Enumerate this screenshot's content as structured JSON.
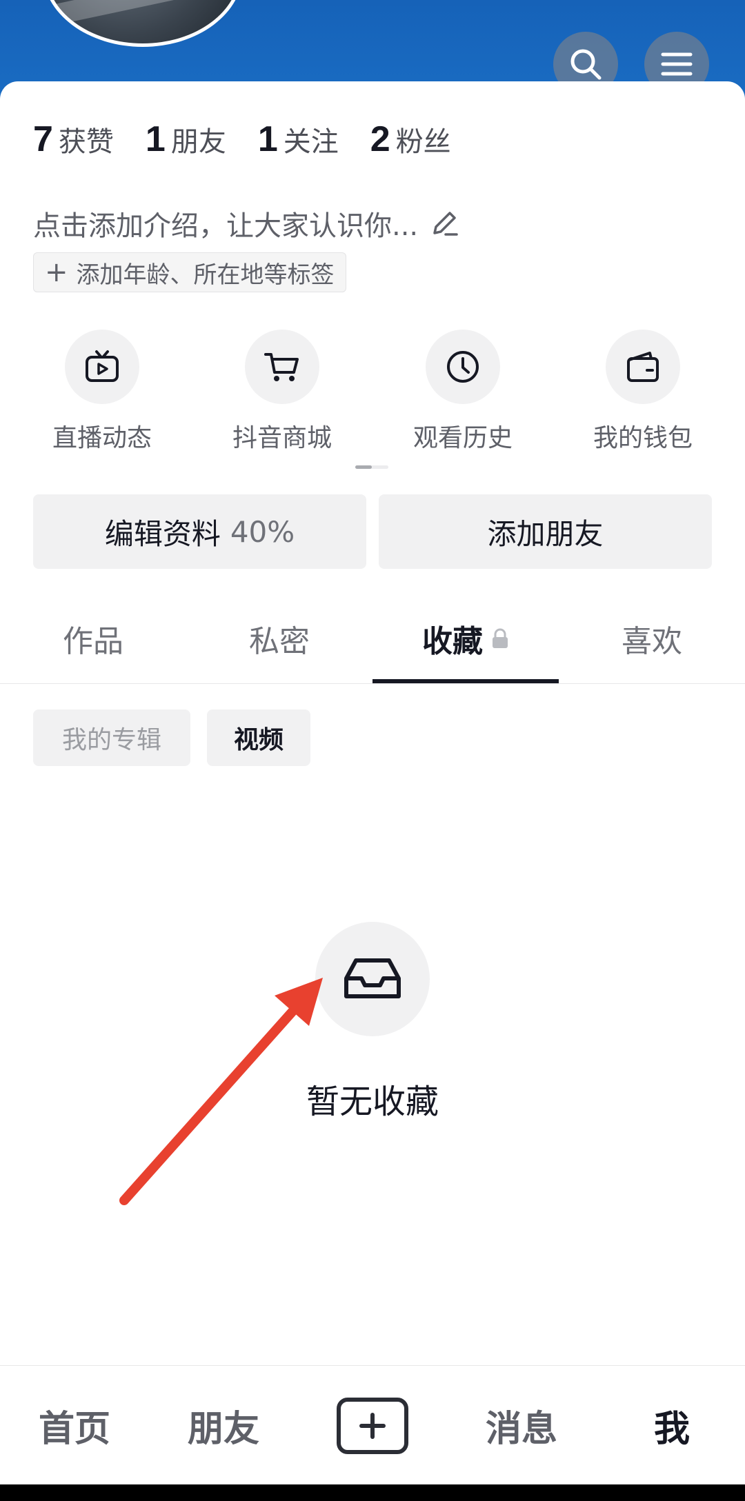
{
  "profile": {
    "stats": [
      {
        "num": "7",
        "label": "获赞"
      },
      {
        "num": "1",
        "label": "朋友"
      },
      {
        "num": "1",
        "label": "关注"
      },
      {
        "num": "2",
        "label": "粉丝"
      }
    ],
    "bio": "点击添加介绍，让大家认识你...",
    "tag_button": "添加年龄、所在地等标签"
  },
  "shortcuts": [
    {
      "label": "直播动态",
      "icon": "live-tv-icon"
    },
    {
      "label": "抖音商城",
      "icon": "cart-icon"
    },
    {
      "label": "观看历史",
      "icon": "clock-icon"
    },
    {
      "label": "我的钱包",
      "icon": "wallet-icon"
    }
  ],
  "actions": {
    "edit_profile": "编辑资料",
    "edit_percent": "40%",
    "add_friend": "添加朋友"
  },
  "tabs": [
    {
      "label": "作品"
    },
    {
      "label": "私密"
    },
    {
      "label": "收藏",
      "active": true
    },
    {
      "label": "喜欢"
    }
  ],
  "chips": {
    "album": "我的专辑",
    "video": "视频"
  },
  "empty_state": {
    "text": "暂无收藏",
    "icon": "inbox-tray-icon"
  },
  "bottom_nav": {
    "home": "首页",
    "friends": "朋友",
    "messages": "消息",
    "me": "我"
  },
  "colors": {
    "header_blue": "#1662b8",
    "annotation_arrow": "#e8412f",
    "text_primary": "#161823"
  }
}
